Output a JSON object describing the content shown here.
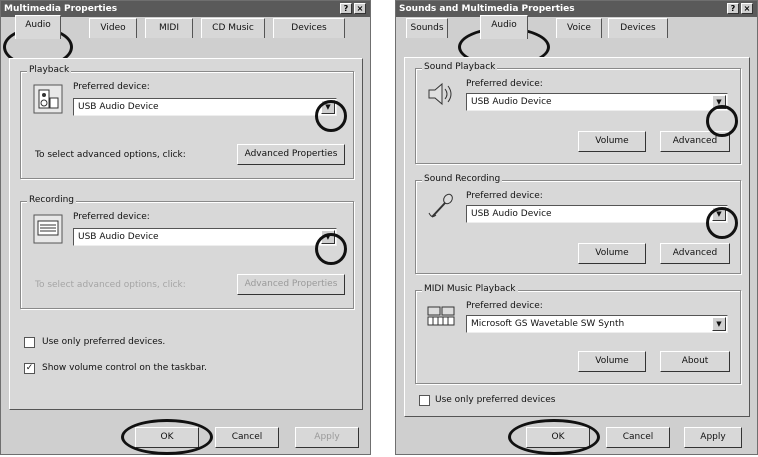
{
  "left": {
    "title": "Multimedia Properties",
    "tabs": [
      "Audio",
      "Video",
      "MIDI",
      "CD Music",
      "Devices"
    ],
    "playback": {
      "group_label": "Playback",
      "preferred_label": "Preferred device:",
      "device": "USB Audio Device",
      "advanced_hint": "To select advanced options, click:",
      "advanced_button": "Advanced Properties"
    },
    "recording": {
      "group_label": "Recording",
      "preferred_label": "Preferred device:",
      "device": "USB Audio Device",
      "advanced_hint": "To select advanced options, click:",
      "advanced_button": "Advanced Properties"
    },
    "use_only_preferred": "Use only preferred devices.",
    "show_volume": "Show volume control on the taskbar.",
    "buttons": {
      "ok": "OK",
      "cancel": "Cancel",
      "apply": "Apply"
    },
    "title_buttons": [
      "?",
      "×"
    ]
  },
  "right": {
    "title": "Sounds and Multimedia Properties",
    "tabs": [
      "Sounds",
      "Audio",
      "Voice",
      "Devices"
    ],
    "sound_playback": {
      "group_label": "Sound Playback",
      "preferred_label": "Preferred device:",
      "device": "USB Audio Device",
      "volume_button": "Volume",
      "advanced_button": "Advanced"
    },
    "sound_recording": {
      "group_label": "Sound Recording",
      "preferred_label": "Preferred device:",
      "device": "USB Audio Device",
      "volume_button": "Volume",
      "advanced_button": "Advanced"
    },
    "midi": {
      "group_label": "MIDI Music Playback",
      "preferred_label": "Preferred device:",
      "device": "Microsoft GS Wavetable SW Synth",
      "volume_button": "Volume",
      "about_button": "About"
    },
    "use_only_preferred": "Use only preferred devices",
    "buttons": {
      "ok": "OK",
      "cancel": "Cancel",
      "apply": "Apply"
    },
    "title_buttons": [
      "?",
      "×"
    ]
  },
  "icons": {
    "speaker_playback": "speaker-icon",
    "mic_recording": "microphone-icon",
    "midi": "midi-keyboard-icon",
    "dropdown": "chevron-down-icon"
  },
  "checkbox_states": {
    "left_use_only_preferred": false,
    "left_show_volume": true,
    "right_use_only_preferred": false
  }
}
